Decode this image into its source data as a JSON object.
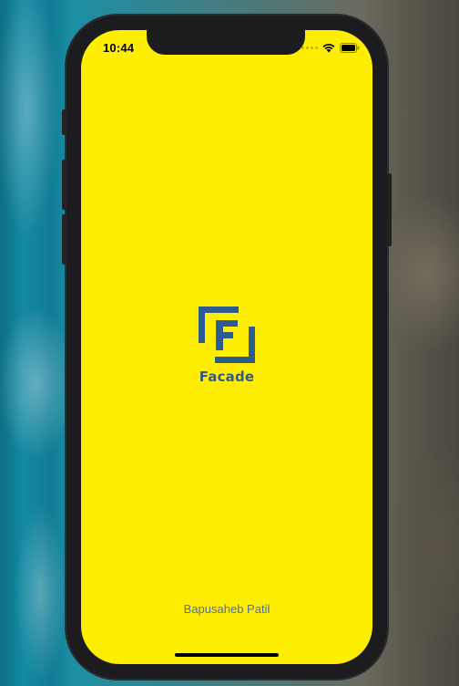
{
  "status_bar": {
    "time": "10:44",
    "icons": [
      "signal-dots-icon",
      "wifi-icon",
      "battery-icon"
    ]
  },
  "splash": {
    "logo_letter": "F",
    "brand_name": "Facade",
    "author": "Bapusaheb Patil"
  },
  "colors": {
    "background": "#ffee00",
    "brand": "#2e5b8f",
    "author_text": "#4a6fa0"
  }
}
